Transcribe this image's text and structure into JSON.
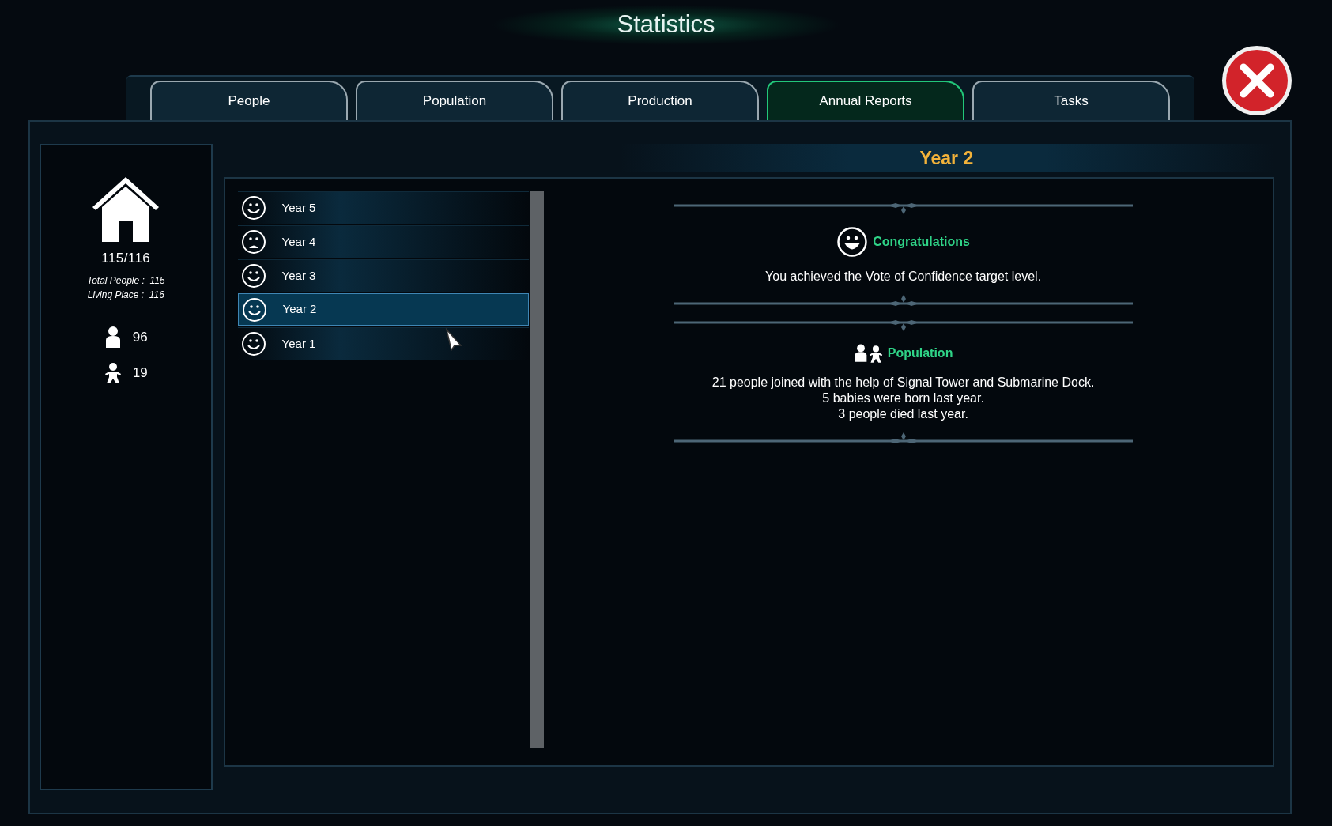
{
  "window": {
    "title": "Statistics"
  },
  "tabs": [
    {
      "label": "People",
      "selected": false
    },
    {
      "label": "Population",
      "selected": false
    },
    {
      "label": "Production",
      "selected": false
    },
    {
      "label": "Annual Reports",
      "selected": true
    },
    {
      "label": "Tasks",
      "selected": false
    }
  ],
  "summary": {
    "capacity": "115/116",
    "total_people": "Total People :  115",
    "living_place": "Living Place :  116",
    "adults": "96",
    "children": "19"
  },
  "years": [
    {
      "label": "Year 5",
      "kind": "happy",
      "selected": false
    },
    {
      "label": "Year 4",
      "kind": "sad",
      "selected": false
    },
    {
      "label": "Year 3",
      "kind": "happy",
      "selected": false
    },
    {
      "label": "Year 2",
      "kind": "happy",
      "selected": true
    },
    {
      "label": "Year 1",
      "kind": "happy",
      "selected": false
    }
  ],
  "report": {
    "title": "Year 2",
    "sections": [
      {
        "kind": "happy",
        "heading": "Congratulations",
        "lines": [
          "You achieved the Vote of Confidence target level."
        ]
      },
      {
        "kind": "population",
        "heading": "Population",
        "lines": [
          "21 people joined with the help of Signal Tower and Submarine Dock.",
          "5 babies were born last year.",
          "3 people died last year."
        ]
      }
    ]
  }
}
